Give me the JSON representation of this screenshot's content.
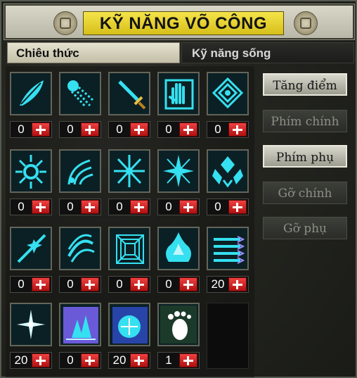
{
  "title": "KỸ NĂNG VÕ CÔNG",
  "tabs": [
    {
      "label": "Chiêu thức",
      "active": true
    },
    {
      "label": "Kỹ năng sống",
      "active": false
    }
  ],
  "side_buttons": [
    {
      "label": "Tăng điểm",
      "enabled": true
    },
    {
      "label": "Phím chính",
      "enabled": false
    },
    {
      "label": "Phím phụ",
      "enabled": true
    },
    {
      "label": "Gỡ chính",
      "enabled": false
    },
    {
      "label": "Gỡ phụ",
      "enabled": false
    }
  ],
  "skills": [
    {
      "icon": "feather-skill-icon",
      "points": "0"
    },
    {
      "icon": "phoenix-skill-icon",
      "points": "0"
    },
    {
      "icon": "sword-skill-icon",
      "points": "0"
    },
    {
      "icon": "palm-skill-icon",
      "points": "0"
    },
    {
      "icon": "lattice-skill-icon",
      "points": "0"
    },
    {
      "icon": "radiant-circle-skill-icon",
      "points": "0"
    },
    {
      "icon": "wave-arc-skill-icon",
      "points": "0"
    },
    {
      "icon": "snowflake-skill-icon",
      "points": "0"
    },
    {
      "icon": "star-burst-skill-icon",
      "points": "0"
    },
    {
      "icon": "diamond-shield-skill-icon",
      "points": "0"
    },
    {
      "icon": "slash-star-skill-icon",
      "points": "0"
    },
    {
      "icon": "swirl-skill-icon",
      "points": "0"
    },
    {
      "icon": "tunnel-skill-icon",
      "points": "0"
    },
    {
      "icon": "flame-skill-icon",
      "points": "0"
    },
    {
      "icon": "arrows-skill-icon",
      "points": "20"
    },
    {
      "icon": "spark-skill-icon",
      "points": "20"
    },
    {
      "icon": "pine-skill-icon",
      "points": "0"
    },
    {
      "icon": "orb-skill-icon",
      "points": "20"
    },
    {
      "icon": "footprint-skill-icon",
      "points": "1"
    }
  ],
  "colors": {
    "accent": "#e8d43a",
    "icon_glow": "#35e0f0",
    "plus": "#d82020"
  }
}
